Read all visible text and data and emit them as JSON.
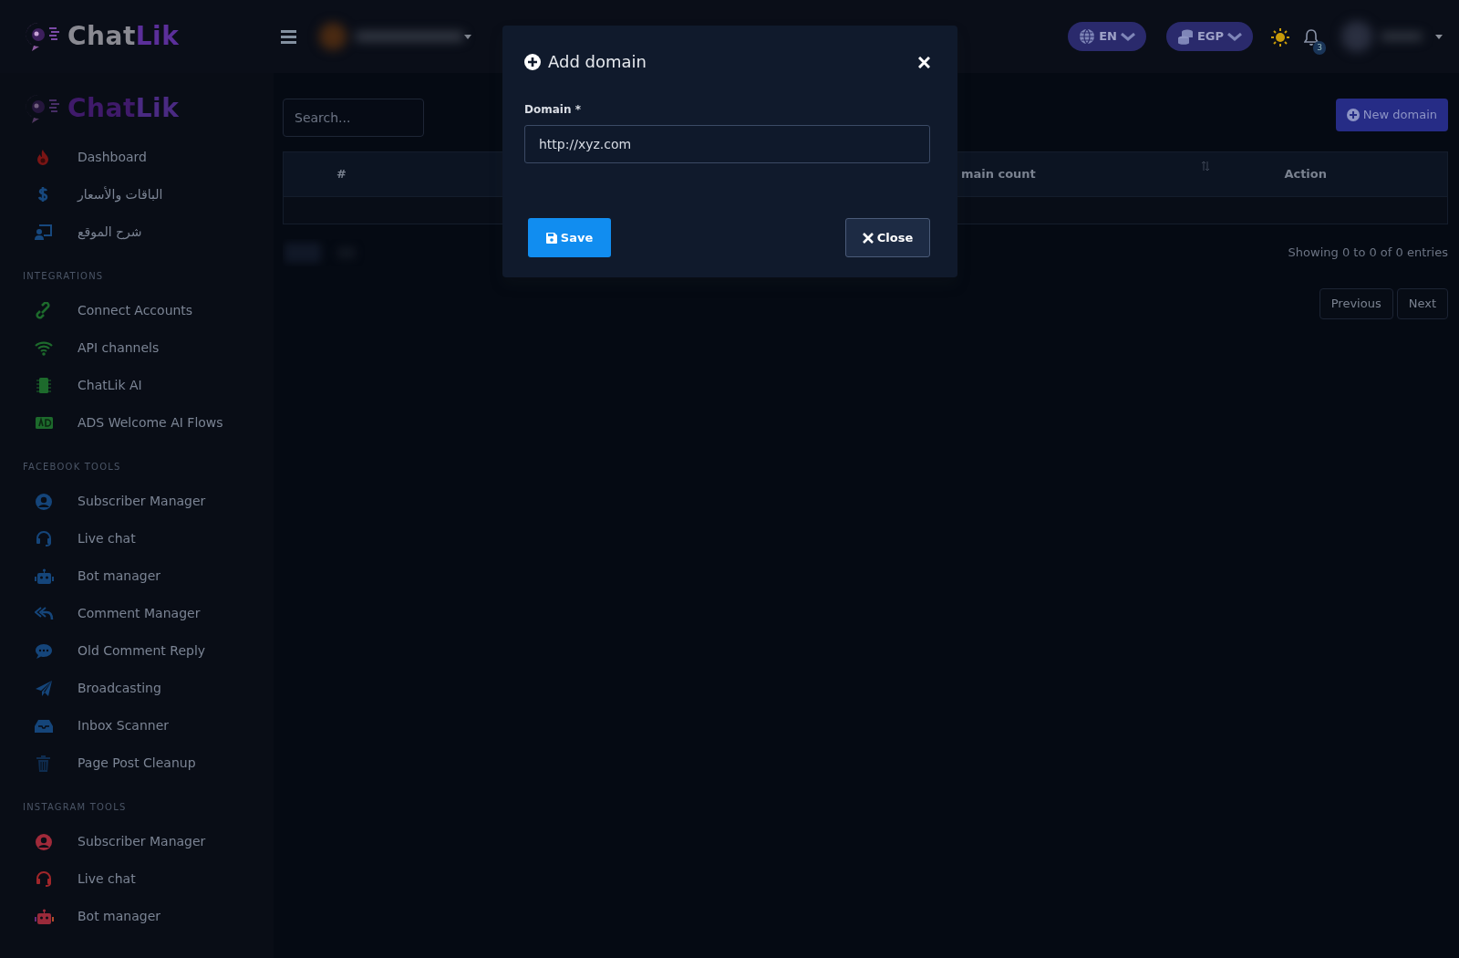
{
  "header": {
    "logo_parts": [
      "Chat",
      "Lik"
    ],
    "language": "EN",
    "currency": "EGP",
    "notification_count": "3"
  },
  "sidebar": {
    "logo_parts": [
      "Chat",
      "Lik"
    ],
    "sections": [
      {
        "items": [
          {
            "label": "Dashboard"
          },
          {
            "label": "الباقات والأسعار"
          },
          {
            "label": "شرح الموقع"
          }
        ]
      },
      {
        "heading": "INTEGRATIONS",
        "items": [
          {
            "label": "Connect Accounts"
          },
          {
            "label": "API channels"
          },
          {
            "label": "ChatLik AI"
          },
          {
            "label": "ADS Welcome AI Flows"
          }
        ]
      },
      {
        "heading": "FACEBOOK TOOLS",
        "items": [
          {
            "label": "Subscriber Manager"
          },
          {
            "label": "Live chat"
          },
          {
            "label": "Bot manager"
          },
          {
            "label": "Comment Manager"
          },
          {
            "label": "Old Comment Reply"
          },
          {
            "label": "Broadcasting"
          },
          {
            "label": "Inbox Scanner"
          },
          {
            "label": "Page Post Cleanup"
          }
        ]
      },
      {
        "heading": "INSTAGRAM TOOLS",
        "items": [
          {
            "label": "Subscriber Manager"
          },
          {
            "label": "Live chat"
          },
          {
            "label": "Bot manager"
          }
        ]
      }
    ]
  },
  "content": {
    "search": {
      "placeholder": "Search..."
    },
    "new_button": "New domain",
    "table": {
      "columns": [
        {
          "label": "#"
        },
        {
          "label": "main count"
        },
        {
          "label": "Action"
        }
      ]
    },
    "info": "Showing 0 to 0 of 0 entries",
    "pagination": [
      "Previous",
      "Next"
    ]
  },
  "modal": {
    "title": "Add domain",
    "field": {
      "label": "Domain *",
      "value": "http://xyz.com"
    },
    "buttons": [
      {
        "kind": "save",
        "label": "Save"
      },
      {
        "kind": "close",
        "label": "Close"
      }
    ]
  }
}
